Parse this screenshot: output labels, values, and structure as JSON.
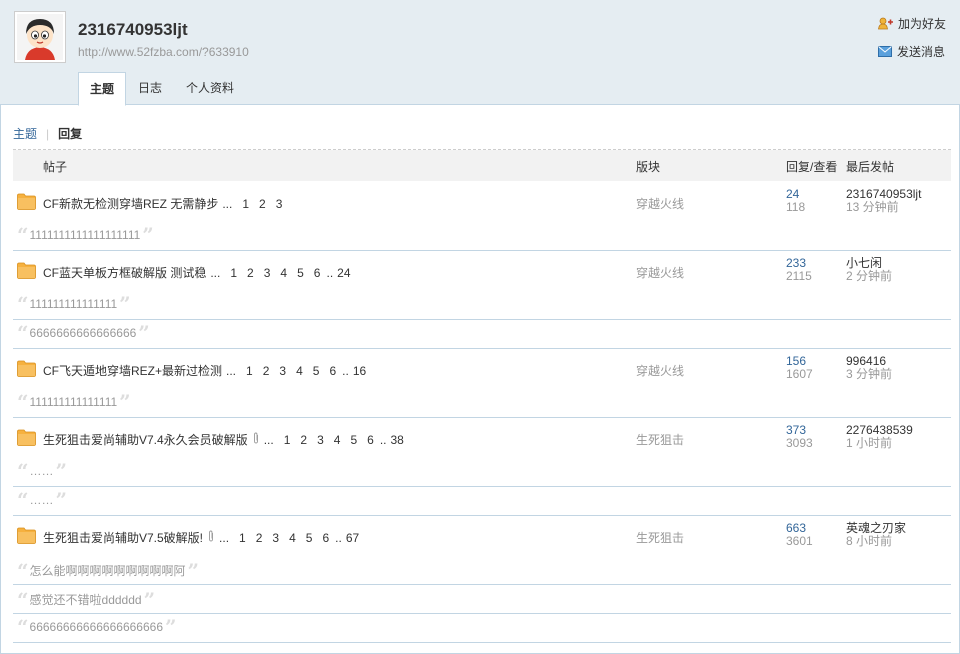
{
  "user": {
    "name": "2316740953ljt",
    "url": "http://www.52fzba.com/?633910"
  },
  "actions": {
    "add_friend": "加为好友",
    "send_message": "发送消息"
  },
  "tabs": [
    "主题",
    "日志",
    "个人资料"
  ],
  "subnav": {
    "threads": "主题",
    "replies": "回复"
  },
  "table_headers": {
    "post": "帖子",
    "forum": "版块",
    "replies_views": "回复/查看",
    "last_post": "最后发帖"
  },
  "threads": [
    {
      "title": "CF新款无检测穿墙REZ 无需静步",
      "attachment": false,
      "pages": [
        "1",
        "2",
        "3"
      ],
      "last_page": "",
      "forum": "穿越火线",
      "replies": "24",
      "views": "118",
      "last_user": "2316740953ljt",
      "last_time": "13 分钟前",
      "quotes": [
        "1111111111111111111"
      ]
    },
    {
      "title": "CF蓝天单板方框破解版 测试稳",
      "attachment": false,
      "pages": [
        "1",
        "2",
        "3",
        "4",
        "5",
        "6"
      ],
      "last_page": "24",
      "forum": "穿越火线",
      "replies": "233",
      "views": "2115",
      "last_user": "小七闲",
      "last_time": "2 分钟前",
      "quotes": [
        "111111111111111",
        "6666666666666666"
      ]
    },
    {
      "title": "CF飞天遁地穿墙REZ+最新过检测",
      "attachment": false,
      "pages": [
        "1",
        "2",
        "3",
        "4",
        "5",
        "6"
      ],
      "last_page": "16",
      "forum": "穿越火线",
      "replies": "156",
      "views": "1607",
      "last_user": "996416",
      "last_time": "3 分钟前",
      "quotes": [
        "111111111111111"
      ]
    },
    {
      "title": "生死狙击爱尚辅助V7.4永久会员破解版",
      "attachment": true,
      "pages": [
        "1",
        "2",
        "3",
        "4",
        "5",
        "6"
      ],
      "last_page": "38",
      "forum": "生死狙击",
      "replies": "373",
      "views": "3093",
      "last_user": "2276438539",
      "last_time": "1 小时前",
      "quotes": [
        "……",
        "……"
      ]
    },
    {
      "title": "生死狙击爱尚辅助V7.5破解版!",
      "attachment": true,
      "pages": [
        "1",
        "2",
        "3",
        "4",
        "5",
        "6"
      ],
      "last_page": "67",
      "forum": "生死狙击",
      "replies": "663",
      "views": "3601",
      "last_user": "英魂之刃家",
      "last_time": "8 小时前",
      "quotes": [
        "怎么能啊啊啊啊啊啊啊啊啊阿",
        "感觉还不错啦dddddd",
        "66666666666666666666"
      ]
    }
  ],
  "colors": {
    "header_bg": "#e5edf2",
    "border": "#c2d5e3",
    "link": "#336699",
    "folder": "#f6b13f",
    "muted": "#999999"
  },
  "icons": {
    "add_friend": "add-friend-icon",
    "send_message": "envelope-icon",
    "thread": "folder-icon",
    "attachment": "paperclip-icon"
  }
}
